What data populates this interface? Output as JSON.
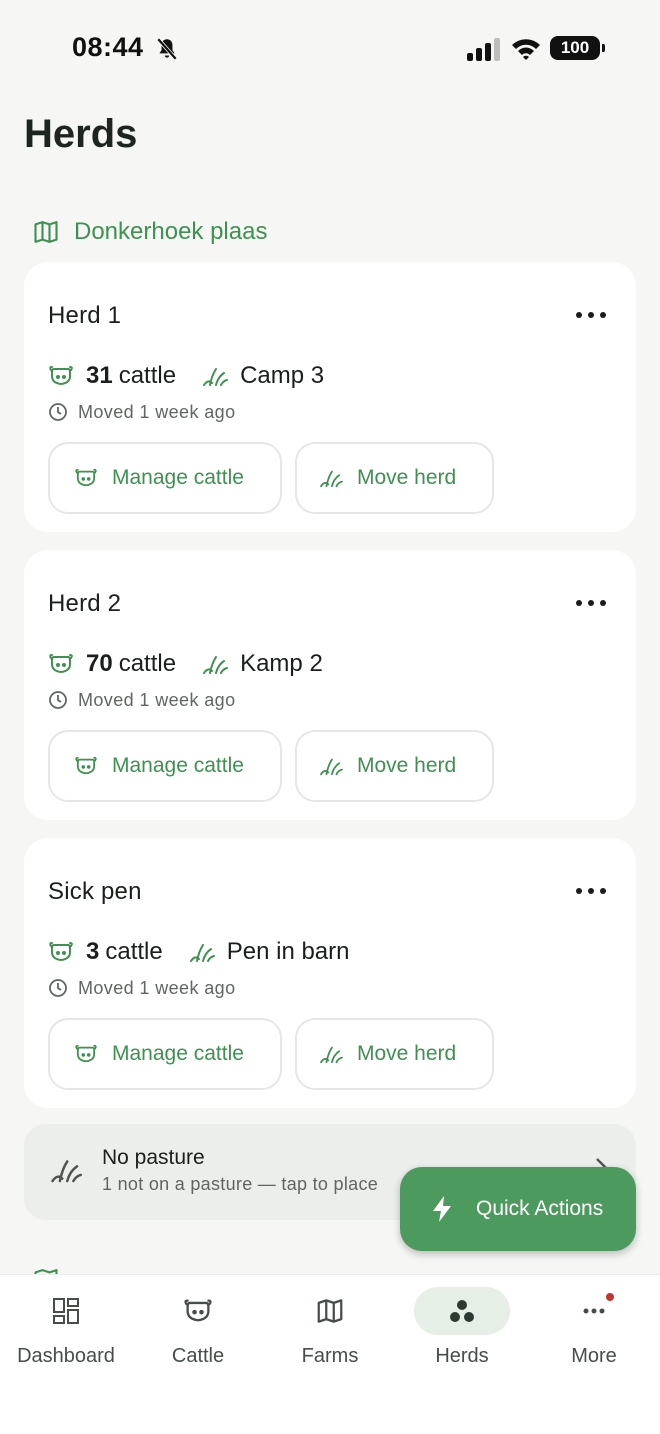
{
  "status_bar": {
    "time": "08:44",
    "battery": "100"
  },
  "page": {
    "title": "Herds"
  },
  "farm": {
    "name": "Donkerhoek plaas"
  },
  "herds": [
    {
      "name": "Herd 1",
      "count": "31",
      "unit": "cattle",
      "location": "Camp 3",
      "moved": "Moved 1 week ago",
      "manage_label": "Manage cattle",
      "move_label": "Move herd"
    },
    {
      "name": "Herd 2",
      "count": "70",
      "unit": "cattle",
      "location": "Kamp 2",
      "moved": "Moved 1 week ago",
      "manage_label": "Manage cattle",
      "move_label": "Move herd"
    },
    {
      "name": "Sick pen",
      "count": "3",
      "unit": "cattle",
      "location": "Pen in barn",
      "moved": "Moved 1 week ago",
      "manage_label": "Manage cattle",
      "move_label": "Move herd"
    }
  ],
  "no_pasture": {
    "title": "No pasture",
    "subtitle": "1 not on a pasture — tap to place"
  },
  "fab": {
    "label": "Quick Actions"
  },
  "nav": [
    {
      "label": "Dashboard",
      "icon": "dashboard-icon"
    },
    {
      "label": "Cattle",
      "icon": "cow-icon"
    },
    {
      "label": "Farms",
      "icon": "map-icon"
    },
    {
      "label": "Herds",
      "icon": "herds-icon",
      "active": true
    },
    {
      "label": "More",
      "icon": "more-icon",
      "badge": true
    }
  ],
  "colors": {
    "accent": "#3f9151",
    "fab": "#4c9a5d",
    "background": "#f6f6f5",
    "badge": "#c6322d"
  }
}
